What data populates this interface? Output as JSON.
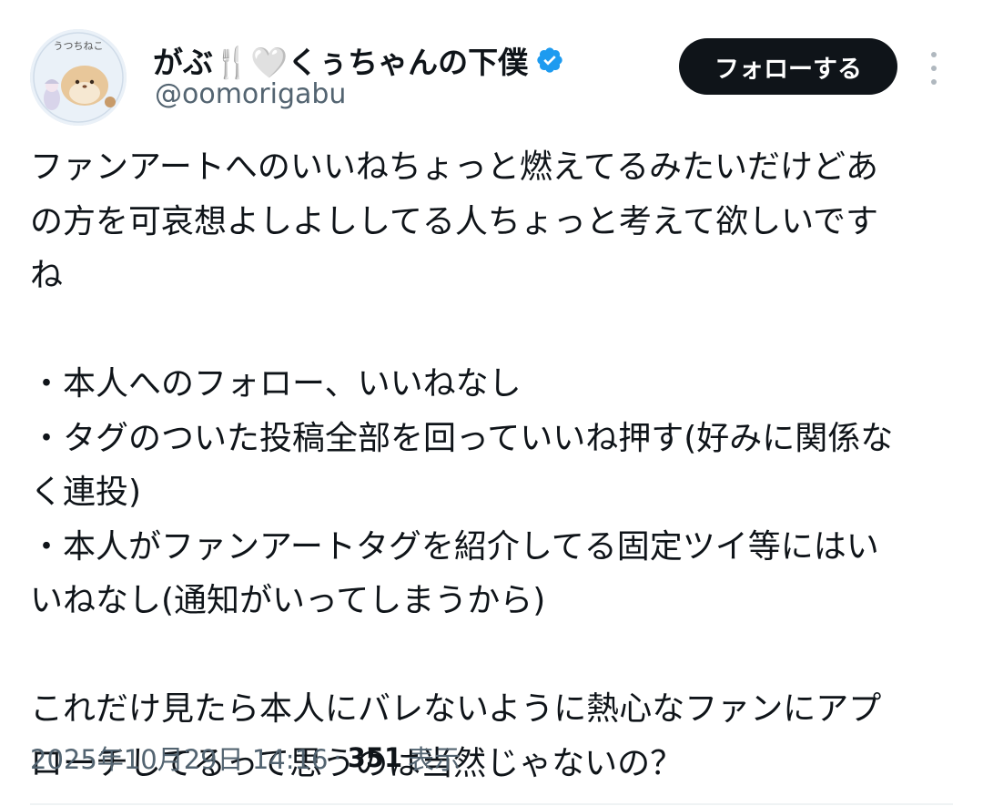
{
  "tweet": {
    "author": {
      "display_name": "がぶ🍴🤍くぅちゃんの下僕",
      "handle": "@oomorigabu",
      "avatar_text": "うつちねこ",
      "verified_icon": "verified-badge-icon",
      "accent_color": "#1d9bf0"
    },
    "follow_label": "フォローする",
    "more_icon": "more-options-icon",
    "body_lines": [
      "ファンアートへのいいねちょっと燃えてるみたいだけどあ",
      "の方を可哀想よしよししてる人ちょっと考えて欲しいです",
      "ね",
      "",
      "・本人へのフォロー、いいねなし",
      "・タグのついた投稿全部を回っていいね押す(好みに関係な",
      "く連投)",
      "・本人がファンアートタグを紹介してる固定ツイ等にはい",
      "いねなし(通知がいってしまうから)",
      "",
      "これだけ見たら本人にバレないように熱心なファンにアプ",
      "ローチしてるって思うのは当然じゃないの？"
    ],
    "timestamp": "2025年10月29日 14:16",
    "separator": "·",
    "views_count": "351",
    "views_label": "表示"
  },
  "colors": {
    "text_primary": "#0f1419",
    "text_secondary": "#536471",
    "follow_bg": "#0f1419",
    "verified": "#1d9bf0"
  }
}
